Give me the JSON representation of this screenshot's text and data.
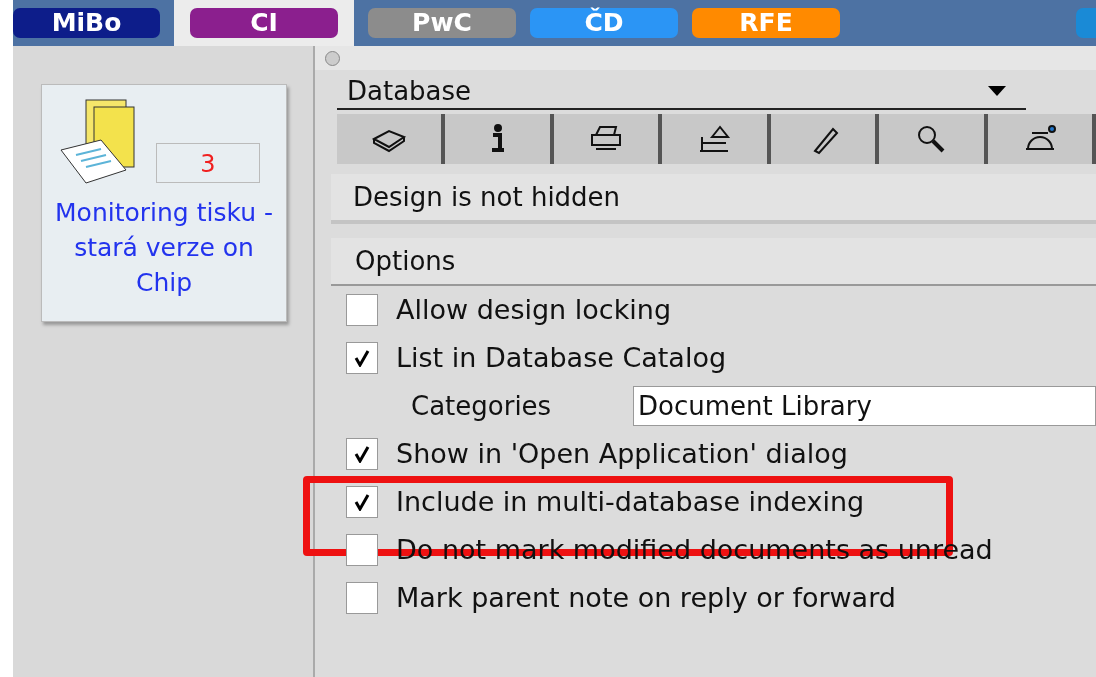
{
  "top_tabs": [
    {
      "label": "MiBo",
      "color": "#0d1d8a",
      "selected": false
    },
    {
      "label": "CI",
      "color": "#8b1f8e",
      "selected": true
    },
    {
      "label": "PwC",
      "color": "#8c8c8c",
      "selected": false
    },
    {
      "label": "ČD",
      "color": "#2b95f5",
      "selected": false
    },
    {
      "label": "RFE",
      "color": "#ff8a00",
      "selected": false
    }
  ],
  "workspace_tile": {
    "count": "3",
    "title": "Monitoring tisku - stará verze on Chip"
  },
  "properties": {
    "selector": "Database",
    "design_status": "Design is not hidden",
    "section_title": "Options",
    "options": [
      {
        "kind": "checkbox",
        "label": "Allow design locking",
        "checked": false,
        "highlighted": false
      },
      {
        "kind": "checkbox",
        "label": "List in Database Catalog",
        "checked": true,
        "highlighted": false
      },
      {
        "kind": "field",
        "label": "Categories",
        "value": "Document Library"
      },
      {
        "kind": "checkbox",
        "label": "Show in 'Open Application' dialog",
        "checked": true,
        "highlighted": false
      },
      {
        "kind": "checkbox",
        "label": "Include in multi-database indexing",
        "checked": true,
        "highlighted": true
      },
      {
        "kind": "checkbox",
        "label": "Do not mark modified documents as unread",
        "checked": false,
        "highlighted": false
      },
      {
        "kind": "checkbox",
        "label": "Mark parent note on reply or forward",
        "checked": false,
        "highlighted": false
      }
    ]
  }
}
